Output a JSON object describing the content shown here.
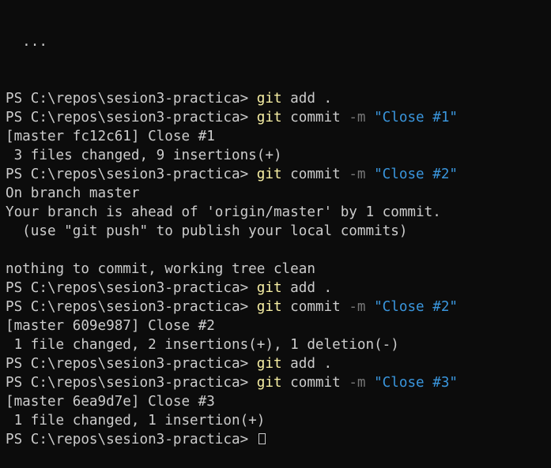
{
  "terminal": {
    "prompt": "PS C:\\repos\\sesion3-practica> ",
    "top_fragment": "  ...  ",
    "lines": [
      {
        "kind": "cmd",
        "tool": "git",
        "args": " add ."
      },
      {
        "kind": "cmd",
        "tool": "git",
        "args": " commit ",
        "flag": "-m",
        "str": "\"Close #1\""
      },
      {
        "kind": "out",
        "text": "[master fc12c61] Close #1"
      },
      {
        "kind": "out",
        "text": " 3 files changed, 9 insertions(+)"
      },
      {
        "kind": "cmd",
        "tool": "git",
        "args": " commit ",
        "flag": "-m",
        "str": "\"Close #2\""
      },
      {
        "kind": "out",
        "text": "On branch master"
      },
      {
        "kind": "out",
        "text": "Your branch is ahead of 'origin/master' by 1 commit."
      },
      {
        "kind": "out",
        "text": "  (use \"git push\" to publish your local commits)"
      },
      {
        "kind": "out",
        "text": ""
      },
      {
        "kind": "out",
        "text": "nothing to commit, working tree clean"
      },
      {
        "kind": "cmd",
        "tool": "git",
        "args": " add ."
      },
      {
        "kind": "cmd",
        "tool": "git",
        "args": " commit ",
        "flag": "-m",
        "str": "\"Close #2\""
      },
      {
        "kind": "out",
        "text": "[master 609e987] Close #2"
      },
      {
        "kind": "out",
        "text": " 1 file changed, 2 insertions(+), 1 deletion(-)"
      },
      {
        "kind": "cmd",
        "tool": "git",
        "args": " add ."
      },
      {
        "kind": "cmd",
        "tool": "git",
        "args": " commit ",
        "flag": "-m",
        "str": "\"Close #3\""
      },
      {
        "kind": "out",
        "text": "[master 6ea9d7e] Close #3"
      },
      {
        "kind": "out",
        "text": " 1 file changed, 1 insertion(+)"
      },
      {
        "kind": "prompt-cursor"
      }
    ]
  },
  "colors": {
    "background": "#0c0c0c",
    "foreground": "#cccccc",
    "command": "#f9f1a5",
    "flag": "#767676",
    "string": "#3a96dd"
  }
}
